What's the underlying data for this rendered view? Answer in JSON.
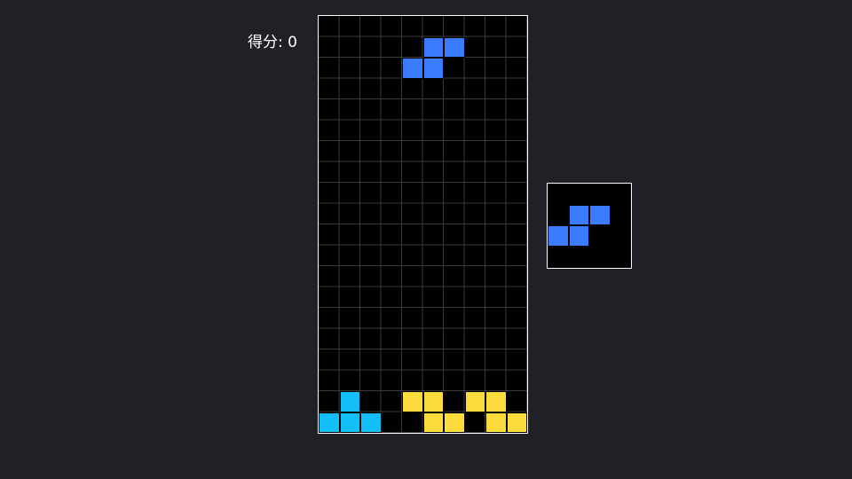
{
  "score": {
    "label": "得分: 0",
    "value": 0
  },
  "board": {
    "columns": 10,
    "rows": 20,
    "active_piece": {
      "type": "S",
      "color": "#3b7cff",
      "cells": [
        [
          5,
          1
        ],
        [
          6,
          1
        ],
        [
          4,
          2
        ],
        [
          5,
          2
        ]
      ]
    },
    "locked_cells": [
      {
        "col": 1,
        "row": 18,
        "color": "#12bff9"
      },
      {
        "col": 0,
        "row": 19,
        "color": "#12bff9"
      },
      {
        "col": 1,
        "row": 19,
        "color": "#12bff9"
      },
      {
        "col": 2,
        "row": 19,
        "color": "#12bff9"
      },
      {
        "col": 4,
        "row": 18,
        "color": "#fbdc3c"
      },
      {
        "col": 5,
        "row": 18,
        "color": "#fbdc3c"
      },
      {
        "col": 5,
        "row": 19,
        "color": "#fbdc3c"
      },
      {
        "col": 6,
        "row": 19,
        "color": "#fbdc3c"
      },
      {
        "col": 7,
        "row": 18,
        "color": "#fbdc3c"
      },
      {
        "col": 8,
        "row": 18,
        "color": "#fbdc3c"
      },
      {
        "col": 8,
        "row": 19,
        "color": "#fbdc3c"
      },
      {
        "col": 9,
        "row": 19,
        "color": "#fbdc3c"
      }
    ]
  },
  "next_piece": {
    "type": "S",
    "color": "#3b7cff",
    "cells": [
      [
        1,
        1
      ],
      [
        2,
        1
      ],
      [
        0,
        2
      ],
      [
        1,
        2
      ]
    ]
  },
  "colors": {
    "background": "#202027",
    "board_background": "#000000",
    "grid_line": "#3a3a3a",
    "frame": "#ffffff",
    "s_piece": "#3b7cff",
    "cyan_piece": "#12bff9",
    "yellow_piece": "#fbdc3c"
  }
}
